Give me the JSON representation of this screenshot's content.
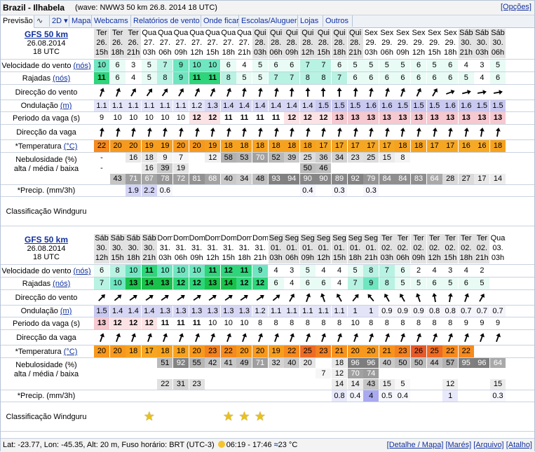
{
  "header": {
    "location": "Brazil - Ilhabela",
    "wave_model": "(wave: NWW3 50 km 26.8. 2014 18 UTC)",
    "options_link": "[Opções]"
  },
  "tabs": [
    {
      "label": "Previsão"
    },
    {
      "label": "∿"
    },
    {
      "label": "2D ▾"
    },
    {
      "label": "Mapa"
    },
    {
      "label": "Webcams"
    },
    {
      "label": "Relatórios de vento"
    },
    {
      "label": "Onde ficar"
    },
    {
      "label": "Escolas/Aluguer"
    },
    {
      "label": "Lojas"
    },
    {
      "label": "Outros"
    }
  ],
  "labels": {
    "wind_speed": "Velocidade do vento",
    "wind_unit": "(nós)",
    "gusts": "Rajadas",
    "gusts_unit": "(nós)",
    "wind_dir": "Direcção do vento",
    "swell": "Ondulação",
    "swell_unit": "(m)",
    "period": "Periodo da vaga (s)",
    "wave_dir": "Direcção da vaga",
    "temp": "*Temperatura",
    "temp_unit": "(°C)",
    "clouds1": "Nebulosidade (%)",
    "clouds2": "alta / média / baixa",
    "precip": "*Precip. (mm/3h)",
    "rating": "Classificação Windguru"
  },
  "sections": [
    {
      "model": "GFS 50 km",
      "date": "26.08.2014",
      "time": "18 UTC",
      "days": [
        "Ter",
        "Ter",
        "Ter",
        "Qua",
        "Qua",
        "Qua",
        "Qua",
        "Qua",
        "Qua",
        "Qua",
        "Qui",
        "Qui",
        "Qui",
        "Qui",
        "Qui",
        "Qui",
        "Qui",
        "Sex",
        "Sex",
        "Sex",
        "Sex",
        "Sex",
        "Sex",
        "Sáb",
        "Sáb",
        "Sáb"
      ],
      "dates": [
        "26.",
        "26.",
        "26.",
        "27.",
        "27.",
        "27.",
        "27.",
        "27.",
        "27.",
        "27.",
        "28.",
        "28.",
        "28.",
        "28.",
        "28.",
        "28.",
        "28.",
        "29.",
        "29.",
        "29.",
        "29.",
        "29.",
        "29.",
        "30.",
        "30.",
        "30."
      ],
      "hours": [
        "15h",
        "18h",
        "21h",
        "03h",
        "06h",
        "09h",
        "12h",
        "15h",
        "18h",
        "21h",
        "03h",
        "06h",
        "09h",
        "12h",
        "15h",
        "18h",
        "21h",
        "03h",
        "06h",
        "09h",
        "12h",
        "15h",
        "18h",
        "21h",
        "03h",
        "06h"
      ],
      "wind": [
        10,
        6,
        3,
        5,
        7,
        9,
        10,
        10,
        6,
        4,
        5,
        6,
        6,
        7,
        7,
        6,
        5,
        5,
        5,
        5,
        6,
        5,
        6,
        4,
        3,
        5
      ],
      "gusts": [
        11,
        6,
        4,
        5,
        8,
        9,
        11,
        11,
        8,
        5,
        5,
        7,
        7,
        8,
        8,
        7,
        6,
        6,
        6,
        6,
        6,
        6,
        6,
        5,
        4,
        6
      ],
      "wind_dir": [
        200,
        200,
        210,
        215,
        215,
        210,
        205,
        205,
        200,
        190,
        190,
        190,
        185,
        180,
        180,
        180,
        185,
        190,
        195,
        200,
        205,
        210,
        250,
        255,
        260,
        260
      ],
      "swell": [
        "1.1",
        "1.1",
        "1.1",
        "1.1",
        "1.1",
        "1.1",
        "1.2",
        "1.3",
        "1.4",
        "1.4",
        "1.4",
        "1.4",
        "1.4",
        "1.4",
        "1.5",
        "1.5",
        "1.5",
        "1.6",
        "1.6",
        "1.5",
        "1.5",
        "1.5",
        "1.6",
        "1.6",
        "1.5",
        "1.5"
      ],
      "period": [
        9,
        10,
        10,
        10,
        10,
        10,
        12,
        12,
        11,
        11,
        11,
        11,
        12,
        12,
        12,
        13,
        13,
        13,
        13,
        13,
        13,
        13,
        13,
        13,
        13,
        13
      ],
      "wave_dir": [
        190,
        190,
        190,
        190,
        190,
        190,
        190,
        190,
        190,
        190,
        190,
        190,
        190,
        190,
        190,
        190,
        190,
        190,
        190,
        190,
        190,
        190,
        190,
        190,
        190,
        190
      ],
      "temp": [
        22,
        20,
        20,
        19,
        19,
        20,
        20,
        19,
        18,
        18,
        18,
        18,
        18,
        18,
        17,
        17,
        17,
        17,
        17,
        18,
        18,
        17,
        17,
        16,
        16,
        18
      ],
      "cloud_high": [
        "-",
        "",
        "16",
        "18",
        "9",
        "7",
        "",
        "12",
        "58",
        "53",
        "70",
        "52",
        "39",
        "25",
        "36",
        "34",
        "23",
        "25",
        "15",
        "8",
        "",
        "",
        "",
        "",
        "",
        ""
      ],
      "cloud_mid": [
        "-",
        "",
        "",
        "16",
        "39",
        "19",
        "",
        "",
        "",
        "",
        "",
        "",
        "",
        "50",
        "46",
        "",
        "",
        "",
        "",
        "",
        "",
        "",
        "",
        "",
        "",
        ""
      ],
      "cloud_low": [
        "",
        "43",
        "71",
        "67",
        "78",
        "72",
        "81",
        "68",
        "40",
        "34",
        "48",
        "93",
        "94",
        "90",
        "90",
        "89",
        "92",
        "79",
        "84",
        "84",
        "83",
        "64",
        "28",
        "27",
        "17",
        "14"
      ],
      "precip": [
        "",
        "",
        "1.9",
        "2.2",
        "0.6",
        "",
        "",
        "",
        "",
        "",
        "",
        "",
        "",
        "0.4",
        "",
        "0.3",
        "",
        "0.3",
        "",
        "",
        "",
        "",
        "",
        "",
        "",
        ""
      ],
      "stars": [
        0,
        0,
        0,
        0,
        0,
        0,
        0,
        0,
        0,
        0,
        0,
        0,
        0,
        0,
        0,
        0,
        0,
        0,
        0,
        0,
        0,
        0,
        0,
        0,
        0,
        0
      ]
    },
    {
      "model": "GFS 50 km",
      "date": "26.08.2014",
      "time": "18 UTC",
      "days": [
        "Sáb",
        "Sáb",
        "Sáb",
        "Sáb",
        "Dom",
        "Dom",
        "Dom",
        "Dom",
        "Dom",
        "Dom",
        "Dom",
        "Seg",
        "Seg",
        "Seg",
        "Seg",
        "Seg",
        "Seg",
        "Seg",
        "Ter",
        "Ter",
        "Ter",
        "Ter",
        "Ter",
        "Ter",
        "Ter",
        "Qua"
      ],
      "dates": [
        "30.",
        "30.",
        "30.",
        "30.",
        "31.",
        "31.",
        "31.",
        "31.",
        "31.",
        "31.",
        "31.",
        "01.",
        "01.",
        "01.",
        "01.",
        "01.",
        "01.",
        "01.",
        "02.",
        "02.",
        "02.",
        "02.",
        "02.",
        "02.",
        "02.",
        "03."
      ],
      "hours": [
        "12h",
        "15h",
        "18h",
        "21h",
        "03h",
        "06h",
        "09h",
        "12h",
        "15h",
        "18h",
        "21h",
        "03h",
        "06h",
        "09h",
        "12h",
        "15h",
        "18h",
        "21h",
        "03h",
        "06h",
        "09h",
        "12h",
        "15h",
        "18h",
        "21h",
        "03h"
      ],
      "wind": [
        6,
        8,
        10,
        11,
        10,
        10,
        10,
        11,
        12,
        11,
        9,
        4,
        3,
        5,
        4,
        4,
        5,
        8,
        7,
        6,
        2,
        4,
        3,
        4,
        2,
        ""
      ],
      "gusts": [
        7,
        10,
        13,
        14,
        13,
        12,
        12,
        13,
        14,
        12,
        12,
        6,
        4,
        6,
        6,
        4,
        7,
        9,
        8,
        5,
        5,
        6,
        5,
        6,
        5,
        ""
      ],
      "wind_dir": [
        225,
        230,
        235,
        235,
        235,
        235,
        235,
        235,
        235,
        235,
        235,
        230,
        210,
        200,
        160,
        150,
        220,
        140,
        150,
        150,
        160,
        170,
        190,
        200,
        210,
        ""
      ],
      "swell": [
        "1.5",
        "1.4",
        "1.4",
        "1.4",
        "1.3",
        "1.3",
        "1.3",
        "1.3",
        "1.3",
        "1.3",
        "1.2",
        "1.1",
        "1.1",
        "1.1",
        "1.1",
        "1.1",
        "1",
        "1",
        "0.9",
        "0.9",
        "0.9",
        "0.8",
        "0.8",
        "0.7",
        "0.7",
        "0.7"
      ],
      "period": [
        13,
        12,
        12,
        12,
        11,
        11,
        11,
        10,
        10,
        10,
        8,
        8,
        8,
        8,
        8,
        8,
        10,
        8,
        8,
        8,
        8,
        8,
        8,
        9,
        9,
        9
      ],
      "wave_dir": [
        200,
        200,
        200,
        200,
        200,
        200,
        200,
        200,
        200,
        200,
        200,
        200,
        200,
        200,
        200,
        200,
        200,
        200,
        200,
        200,
        200,
        200,
        200,
        200,
        200,
        200
      ],
      "temp": [
        20,
        20,
        18,
        17,
        18,
        18,
        20,
        23,
        22,
        20,
        20,
        19,
        22,
        25,
        23,
        21,
        20,
        20,
        21,
        23,
        26,
        25,
        22,
        22,
        "",
        ""
      ],
      "cloud_high": [
        "",
        "",
        "",
        "",
        "51",
        "92",
        "55",
        "42",
        "41",
        "49",
        "71",
        "32",
        "40",
        "20",
        "",
        "18",
        "96",
        "96",
        "40",
        "50",
        "50",
        "44",
        "57",
        "95",
        "96",
        "64"
      ],
      "cloud_mid": [
        "",
        "",
        "",
        "",
        "",
        "",
        "",
        "",
        "",
        "",
        "",
        "",
        "",
        "",
        "7",
        "12",
        "70",
        "74",
        "",
        "",
        "",
        "",
        "",
        "",
        "",
        ""
      ],
      "cloud_low": [
        "",
        "",
        "",
        "",
        "22",
        "31",
        "23",
        "",
        "",
        "",
        "",
        "",
        "",
        "",
        "",
        "14",
        "14",
        "43",
        "15",
        "5",
        "",
        "",
        "12",
        "",
        "",
        "15"
      ],
      "precip": [
        "",
        "",
        "",
        "",
        "",
        "",
        "",
        "",
        "",
        "",
        "",
        "",
        "",
        "",
        "",
        "0.8",
        "0.4",
        "4",
        "0.5",
        "0.4",
        "",
        "",
        "1",
        "",
        "",
        "0.3"
      ],
      "stars": [
        0,
        0,
        0,
        1,
        0,
        0,
        0,
        0,
        1,
        1,
        1,
        0,
        0,
        0,
        0,
        0,
        0,
        0,
        0,
        0,
        0,
        0,
        0,
        0,
        0,
        0
      ]
    }
  ],
  "footer": {
    "coords": "Lat: -23.77, Lon: -45.35, Alt: 20 m, Fuso horário: BRT (UTC-3)",
    "sun": "06:19 - 17:46",
    "water_temp": "23 °C",
    "links": [
      "[Detalhe / Mapa]",
      "[Marés]",
      "[Arquivo]",
      "[Atalho]"
    ]
  },
  "colors": {
    "accent": "#1030a0",
    "temp_orange": "#f5a623",
    "wind_green": "#2ed57a"
  }
}
